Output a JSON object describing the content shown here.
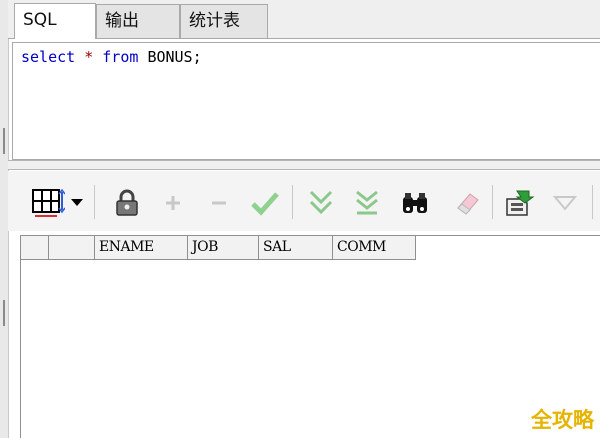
{
  "tabs": [
    {
      "label": "SQL"
    },
    {
      "label": "输出"
    },
    {
      "label": "统计表"
    }
  ],
  "editor": {
    "kw_select": "select",
    "star": "*",
    "kw_from": "from",
    "table": "BONUS;"
  },
  "grid": {
    "columns": [
      "ENAME",
      "JOB",
      "SAL",
      "COMM"
    ]
  },
  "watermark": "全攻略",
  "colors": {
    "keyword": "#0000c8",
    "operator": "#a00000",
    "check_green": "#8fd18f",
    "filter_green": "#8cc88c",
    "watermark": "#e6b400"
  },
  "toolbar_icons": [
    "grid-layout-icon",
    "dropdown-arrow-icon",
    "lock-icon",
    "add-record-icon",
    "delete-record-icon",
    "post-changes-icon",
    "filter-down-icon",
    "filter-clear-icon",
    "find-binoculars-icon",
    "clear-eraser-icon",
    "export-icon",
    "triangle-down-icon"
  ]
}
